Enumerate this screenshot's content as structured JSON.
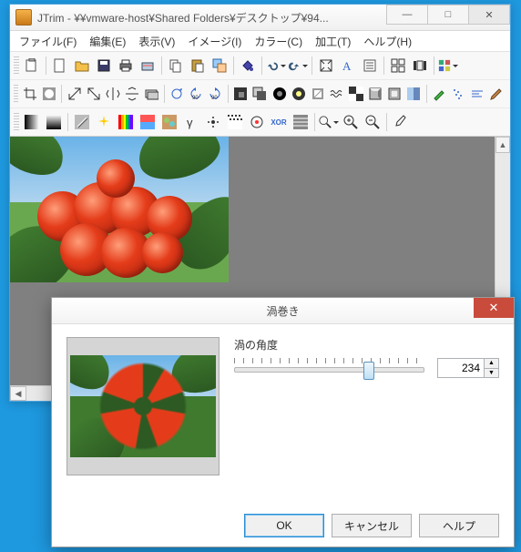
{
  "window": {
    "title": "JTrim - ¥¥vmware-host¥Shared Folders¥デスクトップ¥94...",
    "min": "—",
    "max": "□",
    "close": "✕"
  },
  "menu": {
    "file": "ファイル(F)",
    "edit": "編集(E)",
    "view": "表示(V)",
    "image": "イメージ(I)",
    "color": "カラー(C)",
    "process": "加工(T)",
    "help": "ヘルプ(H)"
  },
  "dialog": {
    "title": "渦巻き",
    "angle_label": "渦の角度",
    "angle_value": "234",
    "ok": "OK",
    "cancel": "キャンセル",
    "help": "ヘルプ",
    "close": "✕"
  }
}
